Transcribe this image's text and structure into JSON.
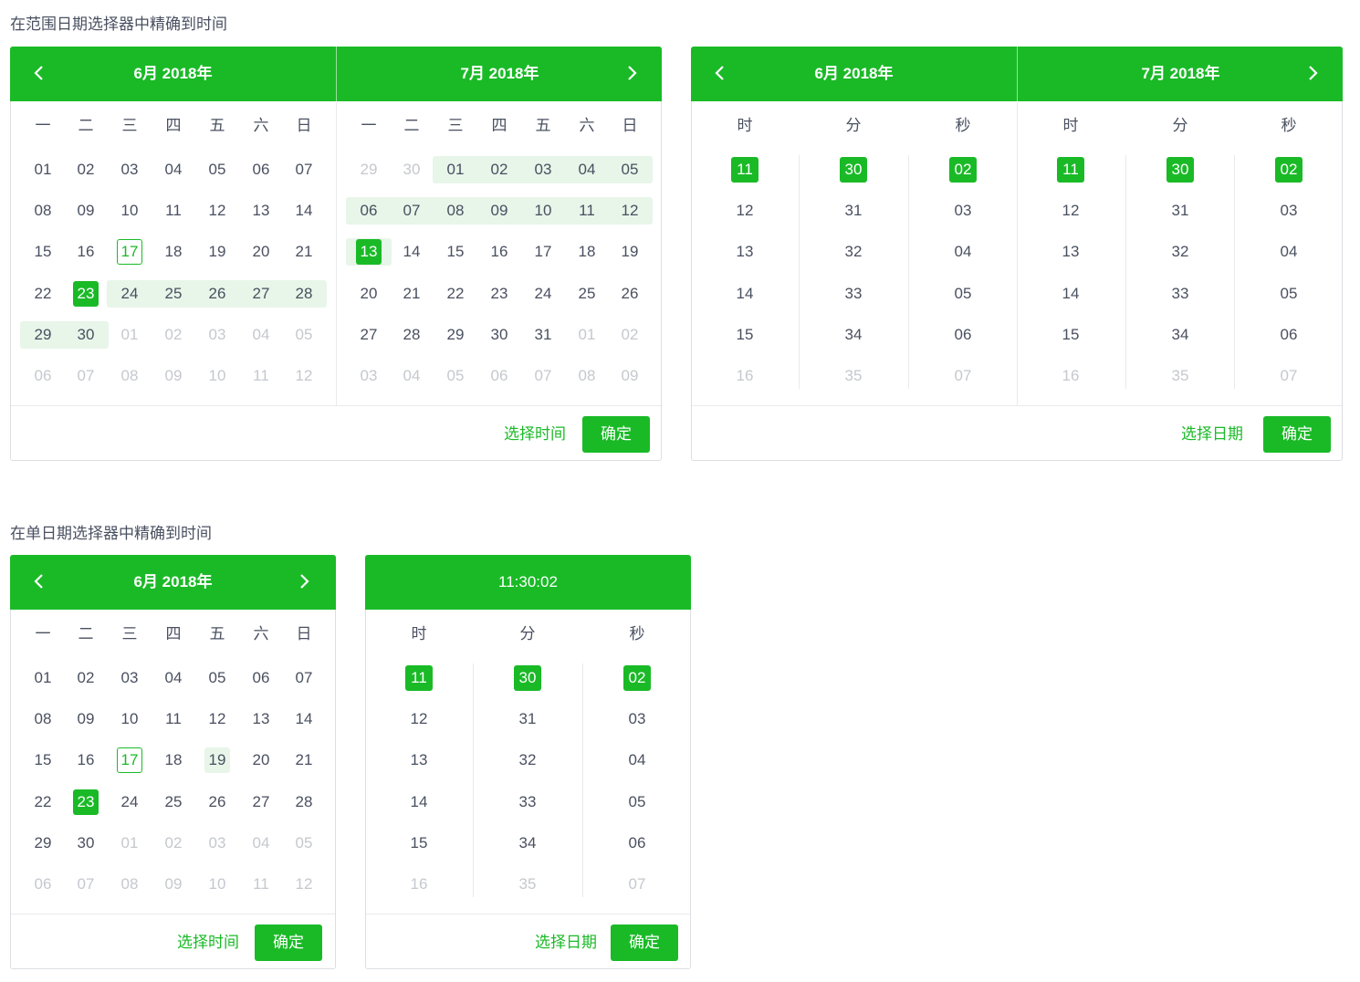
{
  "sections": {
    "range_title": "在范围日期选择器中精确到时间",
    "single_title": "在单日期选择器中精确到时间"
  },
  "weekdays": [
    "一",
    "二",
    "三",
    "四",
    "五",
    "六",
    "日"
  ],
  "time_cols": [
    "时",
    "分",
    "秒"
  ],
  "june_days": [
    "01",
    "02",
    "03",
    "04",
    "05",
    "06",
    "07",
    "08",
    "09",
    "10",
    "11",
    "12",
    "13",
    "14",
    "15",
    "16",
    "17",
    "18",
    "19",
    "20",
    "21",
    "22",
    "23",
    "24",
    "25",
    "26",
    "27",
    "28",
    "29",
    "30",
    "01",
    "02",
    "03",
    "04",
    "05",
    "06",
    "07",
    "08",
    "09",
    "10",
    "11",
    "12"
  ],
  "july_days": [
    "29",
    "30",
    "01",
    "02",
    "03",
    "04",
    "05",
    "06",
    "07",
    "08",
    "09",
    "10",
    "11",
    "12",
    "13",
    "14",
    "15",
    "16",
    "17",
    "18",
    "19",
    "20",
    "21",
    "22",
    "23",
    "24",
    "25",
    "26",
    "27",
    "28",
    "29",
    "30",
    "31",
    "01",
    "02",
    "03",
    "04",
    "05",
    "06",
    "07",
    "08",
    "09"
  ],
  "hours": [
    "11",
    "12",
    "13",
    "14",
    "15",
    "16"
  ],
  "minutes": [
    "30",
    "31",
    "32",
    "33",
    "34",
    "35"
  ],
  "seconds": [
    "02",
    "03",
    "04",
    "05",
    "06",
    "07"
  ],
  "range_date": {
    "left_title": "6月 2018年",
    "right_title": "7月 2018年",
    "select_time": "选择时间",
    "ok": "确定"
  },
  "range_time": {
    "left_title": "6月 2018年",
    "right_title": "7月 2018年",
    "select_date": "选择日期",
    "ok": "确定"
  },
  "single_date": {
    "title": "6月 2018年",
    "select_time": "选择时间",
    "ok": "确定"
  },
  "single_time": {
    "title": "11:30:02",
    "select_date": "选择日期",
    "ok": "确定"
  },
  "colors": {
    "accent": "#1aba27",
    "range_bg": "#e8f5e9",
    "muted": "#c5c8ce",
    "text": "#495060"
  }
}
